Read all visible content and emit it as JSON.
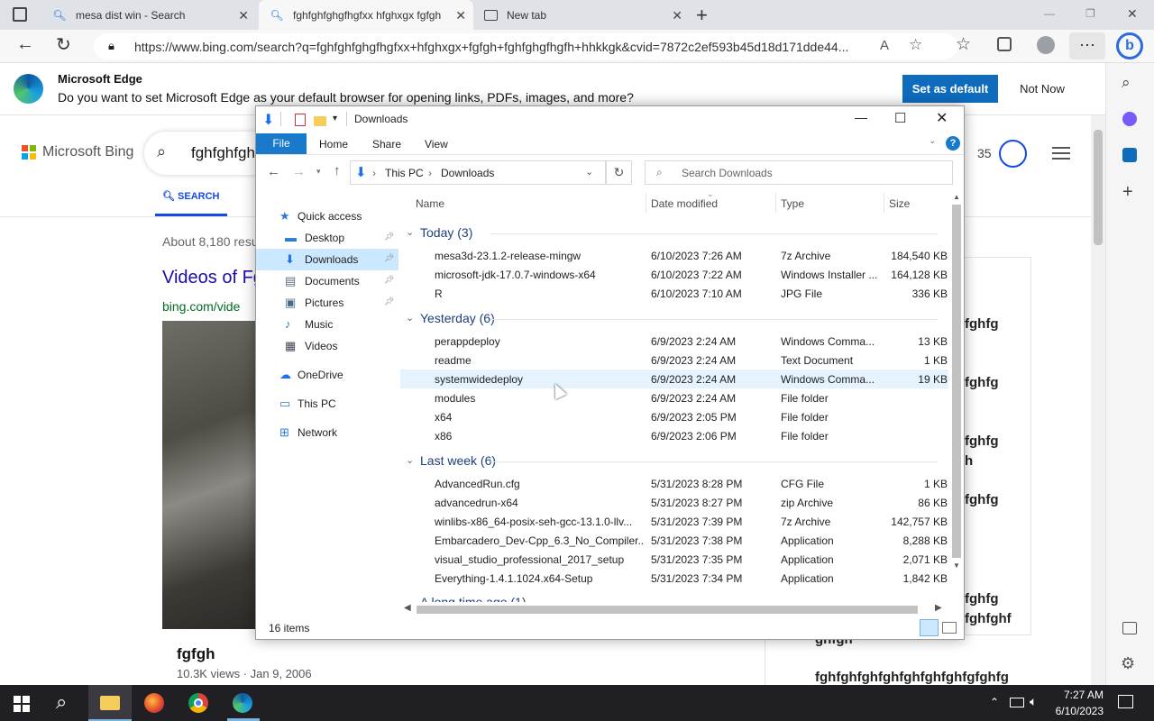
{
  "browser": {
    "tabs": [
      {
        "label": "mesa dist win - Search",
        "close": "✕"
      },
      {
        "label": "fghfghfghgfhgfxx hfghxgx fgfgh",
        "close": "✕"
      },
      {
        "label": "New tab",
        "close": "✕"
      }
    ],
    "new_tab": "+",
    "url": "https://www.bing.com/search?q=fghfghfghgfhgfxx+hfghxgx+fgfgh+fghfghgfhgfh+hhkkgk&cvid=7872c2ef593b45d18d171dde44...",
    "read_aloud": "A",
    "window_controls": [
      "—",
      "❐",
      "✕"
    ]
  },
  "banner": {
    "title": "Microsoft Edge",
    "message": "Do you want to set Microsoft Edge as your default browser for opening links, PDFs, images, and more?",
    "primary": "Set as default",
    "secondary": "Not Now"
  },
  "bing": {
    "logo": "Microsoft Bing",
    "query": "fghfghfgh",
    "rewards": "35",
    "tab_search": "SEARCH",
    "results_count": "About 8,180 resu",
    "videos_title": "Videos of Fg",
    "videos_url": "bing.com/vide",
    "video_title": "fgfgh",
    "video_meta": "10.3K views · Jan 9, 2006",
    "right_items": [
      "fghfg",
      "fghfg",
      "fghfg",
      "h",
      "fghfg",
      "fghfg",
      "fghfghf",
      "ghfgh",
      "fghfghfghfghfghfghfghfgfghfg"
    ]
  },
  "explorer": {
    "qat_title": "Downloads",
    "controls": [
      "—",
      "☐",
      "✕"
    ],
    "ribbon_tabs": [
      "File",
      "Home",
      "Share",
      "View"
    ],
    "help": "?",
    "breadcrumb": [
      "This PC",
      "Downloads"
    ],
    "search_placeholder": "Search Downloads",
    "columns": [
      "Name",
      "Date modified",
      "Type",
      "Size"
    ],
    "nav": [
      {
        "label": "Quick access",
        "icon": "star-icon",
        "pin": false
      },
      {
        "label": "Desktop",
        "icon": "desktop-icon",
        "pin": true
      },
      {
        "label": "Downloads",
        "icon": "download-icon",
        "pin": true
      },
      {
        "label": "Documents",
        "icon": "document-icon",
        "pin": true
      },
      {
        "label": "Pictures",
        "icon": "picture-icon",
        "pin": true
      },
      {
        "label": "Music",
        "icon": "music-icon",
        "pin": false
      },
      {
        "label": "Videos",
        "icon": "video-icon",
        "pin": false
      },
      {
        "label": "OneDrive",
        "icon": "cloud-icon",
        "pin": false
      },
      {
        "label": "This PC",
        "icon": "computer-icon",
        "pin": false
      },
      {
        "label": "Network",
        "icon": "network-icon",
        "pin": false
      }
    ],
    "groups": [
      {
        "label": "Today (3)",
        "files": [
          {
            "name": "mesa3d-23.1.2-release-mingw",
            "date": "6/10/2023 7:26 AM",
            "type": "7z Archive",
            "size": "184,540 KB",
            "icon": "archive-icon"
          },
          {
            "name": "microsoft-jdk-17.0.7-windows-x64",
            "date": "6/10/2023 7:22 AM",
            "type": "Windows Installer ...",
            "size": "164,128 KB",
            "icon": "installer-icon"
          },
          {
            "name": "R",
            "date": "6/10/2023 7:10 AM",
            "type": "JPG File",
            "size": "336 KB",
            "icon": "image-file-icon"
          }
        ]
      },
      {
        "label": "Yesterday (6)",
        "files": [
          {
            "name": "perappdeploy",
            "date": "6/9/2023 2:24 AM",
            "type": "Windows Comma...",
            "size": "13 KB",
            "icon": "script-icon"
          },
          {
            "name": "readme",
            "date": "6/9/2023 2:24 AM",
            "type": "Text Document",
            "size": "1 KB",
            "icon": "text-file-icon"
          },
          {
            "name": "systemwidedeploy",
            "date": "6/9/2023 2:24 AM",
            "type": "Windows Comma...",
            "size": "19 KB",
            "icon": "script-icon"
          },
          {
            "name": "modules",
            "date": "6/9/2023 2:24 AM",
            "type": "File folder",
            "size": "",
            "icon": "folder-icon"
          },
          {
            "name": "x64",
            "date": "6/9/2023 2:05 PM",
            "type": "File folder",
            "size": "",
            "icon": "folder-icon"
          },
          {
            "name": "x86",
            "date": "6/9/2023 2:06 PM",
            "type": "File folder",
            "size": "",
            "icon": "folder-icon"
          }
        ]
      },
      {
        "label": "Last week (6)",
        "files": [
          {
            "name": "AdvancedRun.cfg",
            "date": "5/31/2023 8:28 PM",
            "type": "CFG File",
            "size": "1 KB",
            "icon": "file-icon"
          },
          {
            "name": "advancedrun-x64",
            "date": "5/31/2023 8:27 PM",
            "type": "zip Archive",
            "size": "86 KB",
            "icon": "archive-icon"
          },
          {
            "name": "winlibs-x86_64-posix-seh-gcc-13.1.0-llv...",
            "date": "5/31/2023 7:39 PM",
            "type": "7z Archive",
            "size": "142,757 KB",
            "icon": "archive-icon"
          },
          {
            "name": "Embarcadero_Dev-Cpp_6.3_No_Compiler...",
            "date": "5/31/2023 7:38 PM",
            "type": "Application",
            "size": "8,288 KB",
            "icon": "devcpp-icon"
          },
          {
            "name": "visual_studio_professional_2017_setup",
            "date": "5/31/2023 7:35 PM",
            "type": "Application",
            "size": "2,071 KB",
            "icon": "visual-studio-icon"
          },
          {
            "name": "Everything-1.4.1.1024.x64-Setup",
            "date": "5/31/2023 7:34 PM",
            "type": "Application",
            "size": "1,842 KB",
            "icon": "search-app-icon"
          }
        ]
      }
    ],
    "partial_group": "A long time ago (1)",
    "status": "16 items"
  },
  "taskbar": {
    "time": "7:27 AM",
    "date": "6/10/2023"
  },
  "colors": {
    "accent": "#0f6cbd",
    "file_tab": "#1979ca",
    "highlight": "#cce8ff",
    "hover": "#e5f3ff"
  }
}
